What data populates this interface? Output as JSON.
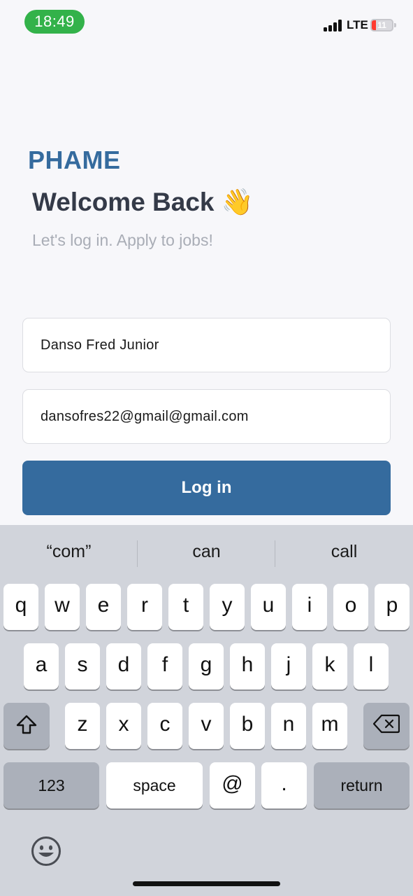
{
  "status_bar": {
    "time": "18:49",
    "network": "LTE",
    "battery_level": "11",
    "colors": {
      "time_pill": "#33b24a",
      "battery_low": "#ff3b30"
    }
  },
  "header": {
    "brand": "PHAME",
    "welcome": "Welcome Back 👋",
    "subtitle": "Let's log in. Apply to jobs!"
  },
  "form": {
    "name_value": "Danso Fred Junior",
    "email_value": "dansofres22@gmail@gmail.com",
    "login_label": "Log in"
  },
  "keyboard": {
    "suggestions": [
      "“com”",
      "can",
      "call"
    ],
    "row1": [
      "q",
      "w",
      "e",
      "r",
      "t",
      "y",
      "u",
      "i",
      "o",
      "p"
    ],
    "row2": [
      "a",
      "s",
      "d",
      "f",
      "g",
      "h",
      "j",
      "k",
      "l"
    ],
    "row3": [
      "z",
      "x",
      "c",
      "v",
      "b",
      "n",
      "m"
    ],
    "numbers_label": "123",
    "space_label": "space",
    "at_label": "@",
    "dot_label": ".",
    "return_label": "return",
    "icons": [
      "shift-icon",
      "backspace-icon",
      "emoji-icon"
    ]
  },
  "colors": {
    "brand": "#356b9e",
    "title": "#343a48",
    "subtitle": "#a9adb6",
    "keyboard_bg": "#d1d4db"
  }
}
